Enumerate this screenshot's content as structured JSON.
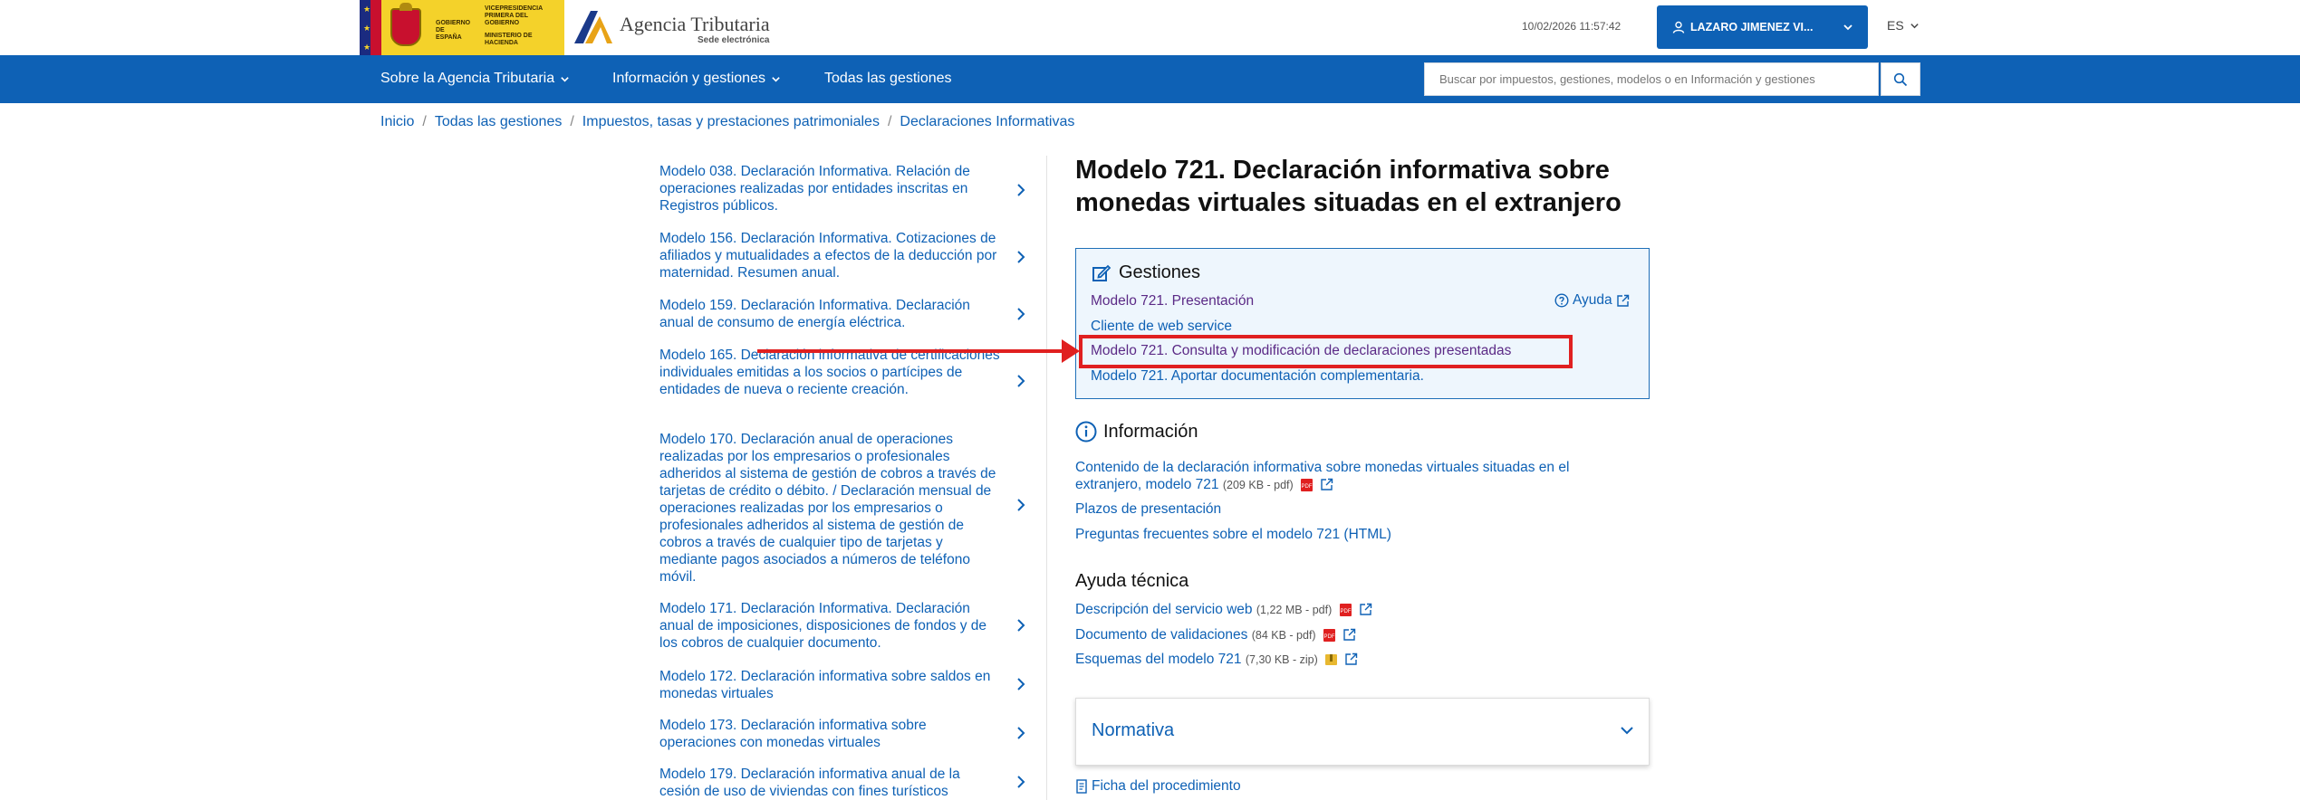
{
  "header": {
    "gov_logo_text": [
      "GOBIERNO DE ESPAÑA",
      "VICEPRESIDENCIA PRIMERA DEL GOBIERNO",
      "MINISTERIO DE HACIENDA"
    ],
    "site_title": "Agencia Tributaria",
    "site_subtitle": "Sede electrónica",
    "datetime": "10/02/2026 11:57:42",
    "user_name": "LAZARO JIMENEZ VI...",
    "language": "ES"
  },
  "nav": {
    "items": [
      {
        "label": "Sobre la Agencia Tributaria",
        "has_dropdown": true
      },
      {
        "label": "Información y gestiones",
        "has_dropdown": true
      },
      {
        "label": "Todas las gestiones",
        "has_dropdown": false
      }
    ],
    "search_placeholder": "Buscar por impuestos, gestiones, modelos o en Información y gestiones"
  },
  "breadcrumb": [
    "Inicio",
    "Todas las gestiones",
    "Impuestos, tasas y prestaciones patrimoniales",
    "Declaraciones Informativas"
  ],
  "sidebar": {
    "items": [
      {
        "label": "Modelo 038. Declaración Informativa. Relación de operaciones realizadas por entidades inscritas en Registros públicos."
      },
      {
        "label": "Modelo 156. Declaración Informativa. Cotizaciones de afiliados y mutualidades a efectos de la deducción por maternidad. Resumen anual."
      },
      {
        "label": "Modelo 159. Declaración Informativa. Declaración anual de consumo de energía eléctrica."
      },
      {
        "label": "Modelo 165. Declaración informativa de certificaciones individuales emitidas a los socios o partícipes de entidades de nueva o reciente creación."
      },
      {
        "label": "Modelo 170. Declaración anual de operaciones realizadas por los empresarios o profesionales adheridos al sistema de gestión de cobros a través de tarjetas de crédito o débito. / Declaración mensual de operaciones realizadas por los empresarios o profesionales adheridos al sistema de gestión de cobros a través de cualquier tipo de tarjetas y mediante pagos asociados a números de teléfono móvil."
      },
      {
        "label": "Modelo 171. Declaración Informativa. Declaración anual de imposiciones, disposiciones de fondos y de los cobros de cualquier documento."
      },
      {
        "label": "Modelo 172. Declaración informativa sobre saldos en monedas virtuales"
      },
      {
        "label": "Modelo 173. Declaración informativa sobre operaciones con monedas virtuales"
      },
      {
        "label": "Modelo 179. Declaración informativa anual de la cesión de uso de viviendas con fines turísticos"
      }
    ]
  },
  "main": {
    "title": "Modelo 721. Declaración informativa sobre monedas virtuales situadas en el extranjero",
    "gestiones": {
      "heading": "Gestiones",
      "help_label": "Ayuda",
      "links": [
        {
          "label": "Modelo 721. Presentación",
          "visited": true
        },
        {
          "label": "Cliente de web service",
          "visited": false
        },
        {
          "label": "Modelo 721. Consulta y modificación de declaraciones presentadas",
          "visited": true,
          "highlighted": true
        },
        {
          "label": "Modelo 721. Aportar documentación complementaria.",
          "visited": false
        }
      ]
    },
    "informacion": {
      "heading": "Información",
      "links": [
        {
          "label": "Contenido de la declaración informativa sobre monedas virtuales situadas en el extranjero, modelo 721",
          "meta": "(209 KB - pdf)"
        },
        {
          "label": "Plazos de presentación",
          "meta": ""
        },
        {
          "label": "Preguntas frecuentes sobre el modelo 721 (HTML)",
          "meta": ""
        }
      ]
    },
    "ayuda_tecnica": {
      "heading": "Ayuda técnica",
      "links": [
        {
          "label": "Descripción del servicio web",
          "meta": "(1,22 MB - pdf)"
        },
        {
          "label": "Documento de validaciones",
          "meta": "(84 KB - pdf)"
        },
        {
          "label": "Esquemas del modelo 721",
          "meta": "(7,30 KB - zip)"
        }
      ]
    },
    "normativa_label": "Normativa",
    "ficha_label": "Ficha del procedimiento"
  },
  "colors": {
    "brand_blue": "#0e61b5",
    "visited_link": "#5b2a86",
    "annotation_red": "#e02020",
    "gov_yellow": "#f4d22a"
  }
}
